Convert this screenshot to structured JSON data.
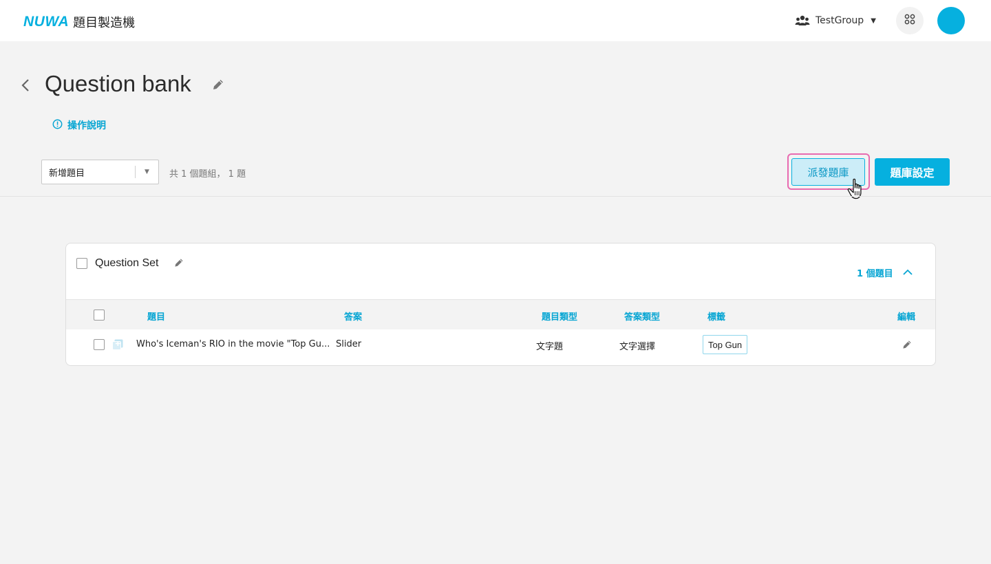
{
  "header": {
    "logo_mark": "NUWA",
    "app_name": "題目製造機",
    "group_name": "TestGroup"
  },
  "page": {
    "title": "Question bank",
    "help_label": "操作說明"
  },
  "toolbar": {
    "add_select_value": "新增題目",
    "summary": "共 1 個題組， 1 題",
    "dispatch_label": "派發題庫",
    "settings_label": "題庫設定"
  },
  "question_set": {
    "title": "Question Set",
    "count_label": "1 個題目",
    "columns": {
      "question": "題目",
      "answer": "答案",
      "question_type": "題目類型",
      "answer_type": "答案類型",
      "tag": "標籤",
      "edit": "編輯"
    },
    "rows": [
      {
        "question": "Who's Iceman's RIO in the movie \"Top Gu...",
        "answer": "Slider",
        "question_type": "文字題",
        "answer_type": "文字選擇",
        "tag": "Top Gun"
      }
    ]
  },
  "colors": {
    "accent": "#06b0df",
    "highlight_ring": "#e86ab0",
    "background": "#f3f3f3"
  }
}
